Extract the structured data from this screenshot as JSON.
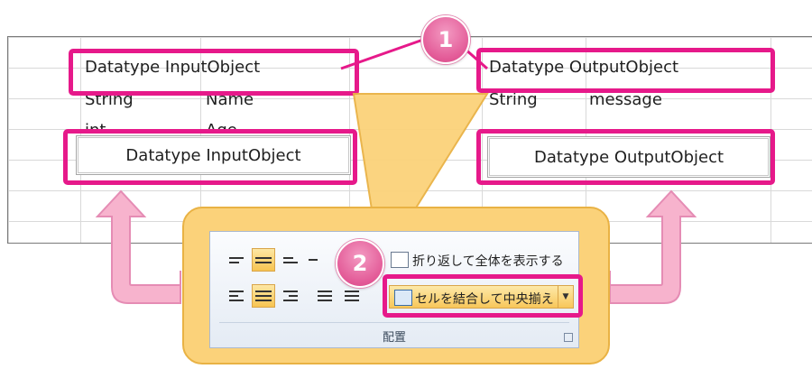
{
  "sheet": {
    "row1": {
      "left": "Datatype InputObject",
      "right": "Datatype OutputObject"
    },
    "row2": {
      "left_type": "String",
      "left_name": "Name",
      "right_type": "String",
      "right_name": "message"
    },
    "row3": {
      "left_type": "int",
      "left_name": "Age"
    },
    "merged": {
      "left": "Datatype InputObject",
      "right": "Datatype OutputObject"
    }
  },
  "badges": {
    "step1": "1",
    "step2": "2"
  },
  "ribbon": {
    "wrap_text_label": "折り返して全体を表示する",
    "merge_center_label": "セルを結合して中央揃え",
    "group_label": "配置"
  },
  "colors": {
    "highlight": "#e6198a",
    "badge": "#e35a97",
    "callout": "#fbd27a",
    "arrow": "#f7b3cd"
  }
}
